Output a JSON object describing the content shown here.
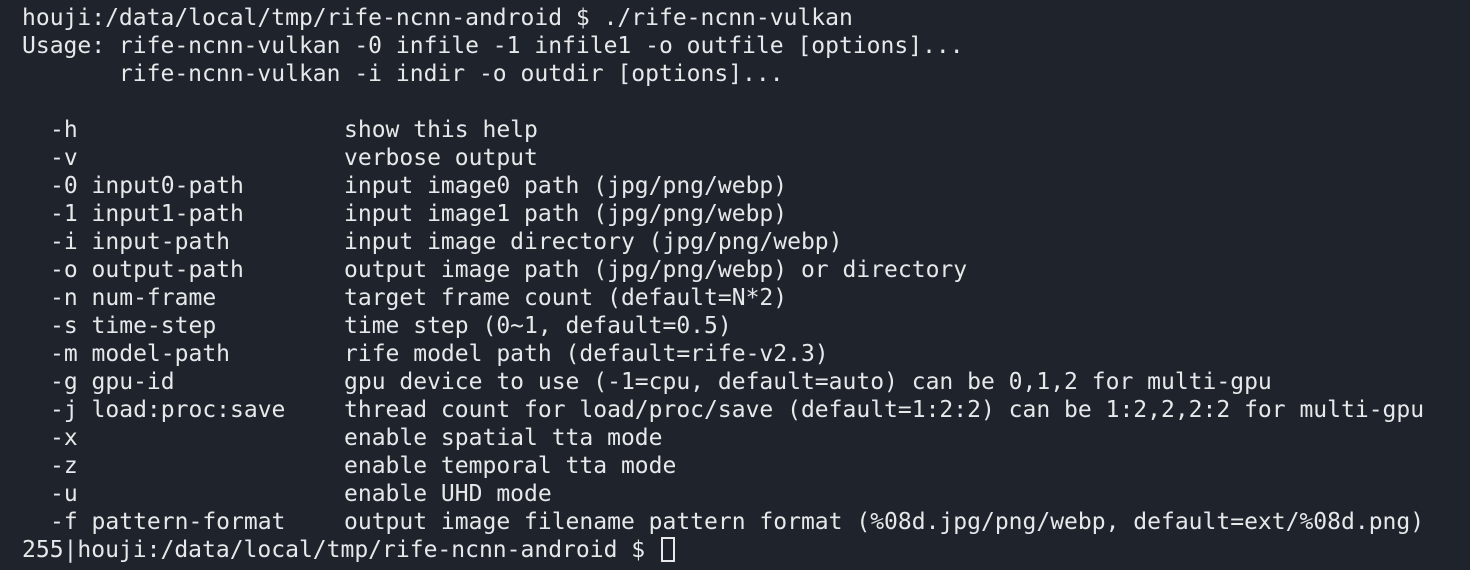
{
  "terminal": {
    "command_line": "houji:/data/local/tmp/rife-ncnn-android $ ./rife-ncnn-vulkan",
    "usage_line1": "Usage: rife-ncnn-vulkan -0 infile -1 infile1 -o outfile [options]...",
    "usage_line2": "       rife-ncnn-vulkan -i indir -o outdir [options]...",
    "options": [
      {
        "flag": "-h",
        "desc": "show this help"
      },
      {
        "flag": "-v",
        "desc": "verbose output"
      },
      {
        "flag": "-0 input0-path",
        "desc": "input image0 path (jpg/png/webp)"
      },
      {
        "flag": "-1 input1-path",
        "desc": "input image1 path (jpg/png/webp)"
      },
      {
        "flag": "-i input-path",
        "desc": "input image directory (jpg/png/webp)"
      },
      {
        "flag": "-o output-path",
        "desc": "output image path (jpg/png/webp) or directory"
      },
      {
        "flag": "-n num-frame",
        "desc": "target frame count (default=N*2)"
      },
      {
        "flag": "-s time-step",
        "desc": "time step (0~1, default=0.5)"
      },
      {
        "flag": "-m model-path",
        "desc": "rife model path (default=rife-v2.3)"
      },
      {
        "flag": "-g gpu-id",
        "desc": "gpu device to use (-1=cpu, default=auto) can be 0,1,2 for multi-gpu"
      },
      {
        "flag": "-j load:proc:save",
        "desc": "thread count for load/proc/save (default=1:2:2) can be 1:2,2,2:2 for multi-gpu"
      },
      {
        "flag": "-x",
        "desc": "enable spatial tta mode"
      },
      {
        "flag": "-z",
        "desc": "enable temporal tta mode"
      },
      {
        "flag": "-u",
        "desc": "enable UHD mode"
      },
      {
        "flag": "-f pattern-format",
        "desc": "output image filename pattern format (%08d.jpg/png/webp, default=ext/%08d.png)"
      }
    ],
    "prompt_line": "255|houji:/data/local/tmp/rife-ncnn-android $ "
  },
  "colors": {
    "background": "#1f242c",
    "foreground": "#e6e8ea"
  }
}
